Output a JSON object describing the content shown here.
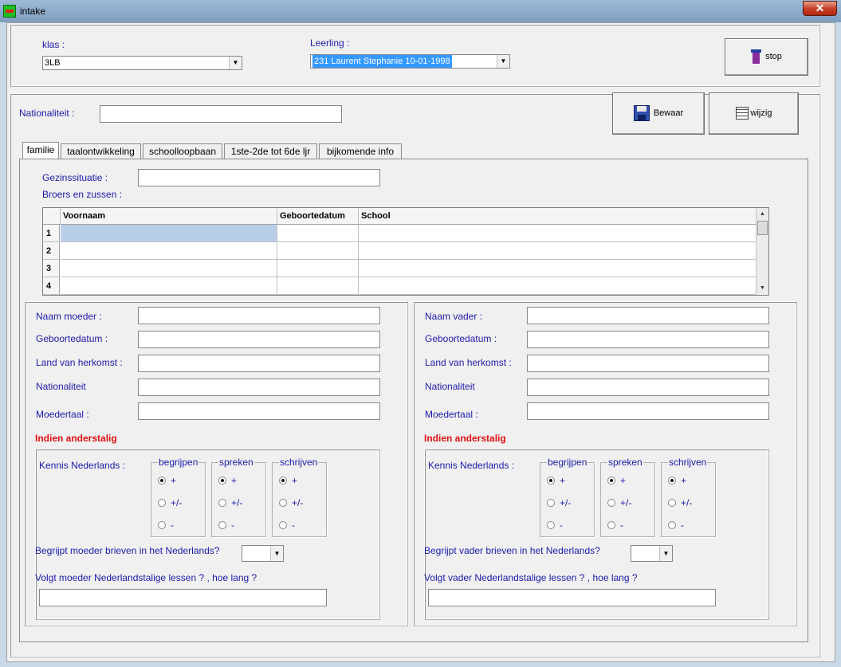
{
  "window": {
    "title": "intake",
    "close_glyph": "✕"
  },
  "header": {
    "klas_label": "klas :",
    "klas_value": "3LB",
    "leerling_label": "Leerling :",
    "leerling_value": "231     Laurent Stephanie 10-01-1998",
    "stop_label": "stop"
  },
  "nationaliteit": {
    "label": "Nationaliteit :",
    "value": ""
  },
  "buttons": {
    "save_label": "Bewaar",
    "edit_label": "wijzig"
  },
  "tabs": [
    {
      "label": "familie",
      "active": true
    },
    {
      "label": "taalontwikkeling",
      "active": false
    },
    {
      "label": "schoolloopbaan",
      "active": false
    },
    {
      "label": "1ste-2de tot 6de ljr",
      "active": false
    },
    {
      "label": "bijkomende info",
      "active": false
    }
  ],
  "familie": {
    "gezinssituatie_label": "Gezinssituatie :",
    "broers_label": "Broers en zussen :",
    "grid": {
      "columns": [
        "Voornaam",
        "Geboortedatum",
        "School"
      ],
      "rows": [
        "1",
        "2",
        "3",
        "4"
      ]
    },
    "moeder": {
      "naam_label": "Naam moeder :",
      "geboortedatum_label": "Geboortedatum :",
      "land_label": "Land van herkomst :",
      "nationaliteit_label": "Nationaliteit",
      "moedertaal_label": "Moedertaal :",
      "anderstalig_title": "Indien anderstalig",
      "kennis_label": "Kennis Nederlands :",
      "brieven_label": "Begrijpt moeder brieven in het Nederlands?",
      "lessen_label": "Volgt moeder Nederlandstalige lessen ? , hoe lang ?"
    },
    "vader": {
      "naam_label": "Naam vader :",
      "geboortedatum_label": "Geboortedatum :",
      "land_label": "Land van herkomst :",
      "nationaliteit_label": "Nationaliteit",
      "moedertaal_label": "Moedertaal :",
      "anderstalig_title": "Indien anderstalig",
      "kennis_label": "Kennis Nederlands :",
      "brieven_label": "Begrijpt vader brieven in het Nederlands?",
      "lessen_label": "Volgt vader Nederlandstalige lessen ? , hoe lang ?"
    },
    "groups": {
      "begrijpen": "begrijpen",
      "spreken": "spreken",
      "schrijven": "schrijven"
    },
    "options": {
      "plus": "+",
      "plusmin": "+/-",
      "min": "-"
    }
  }
}
